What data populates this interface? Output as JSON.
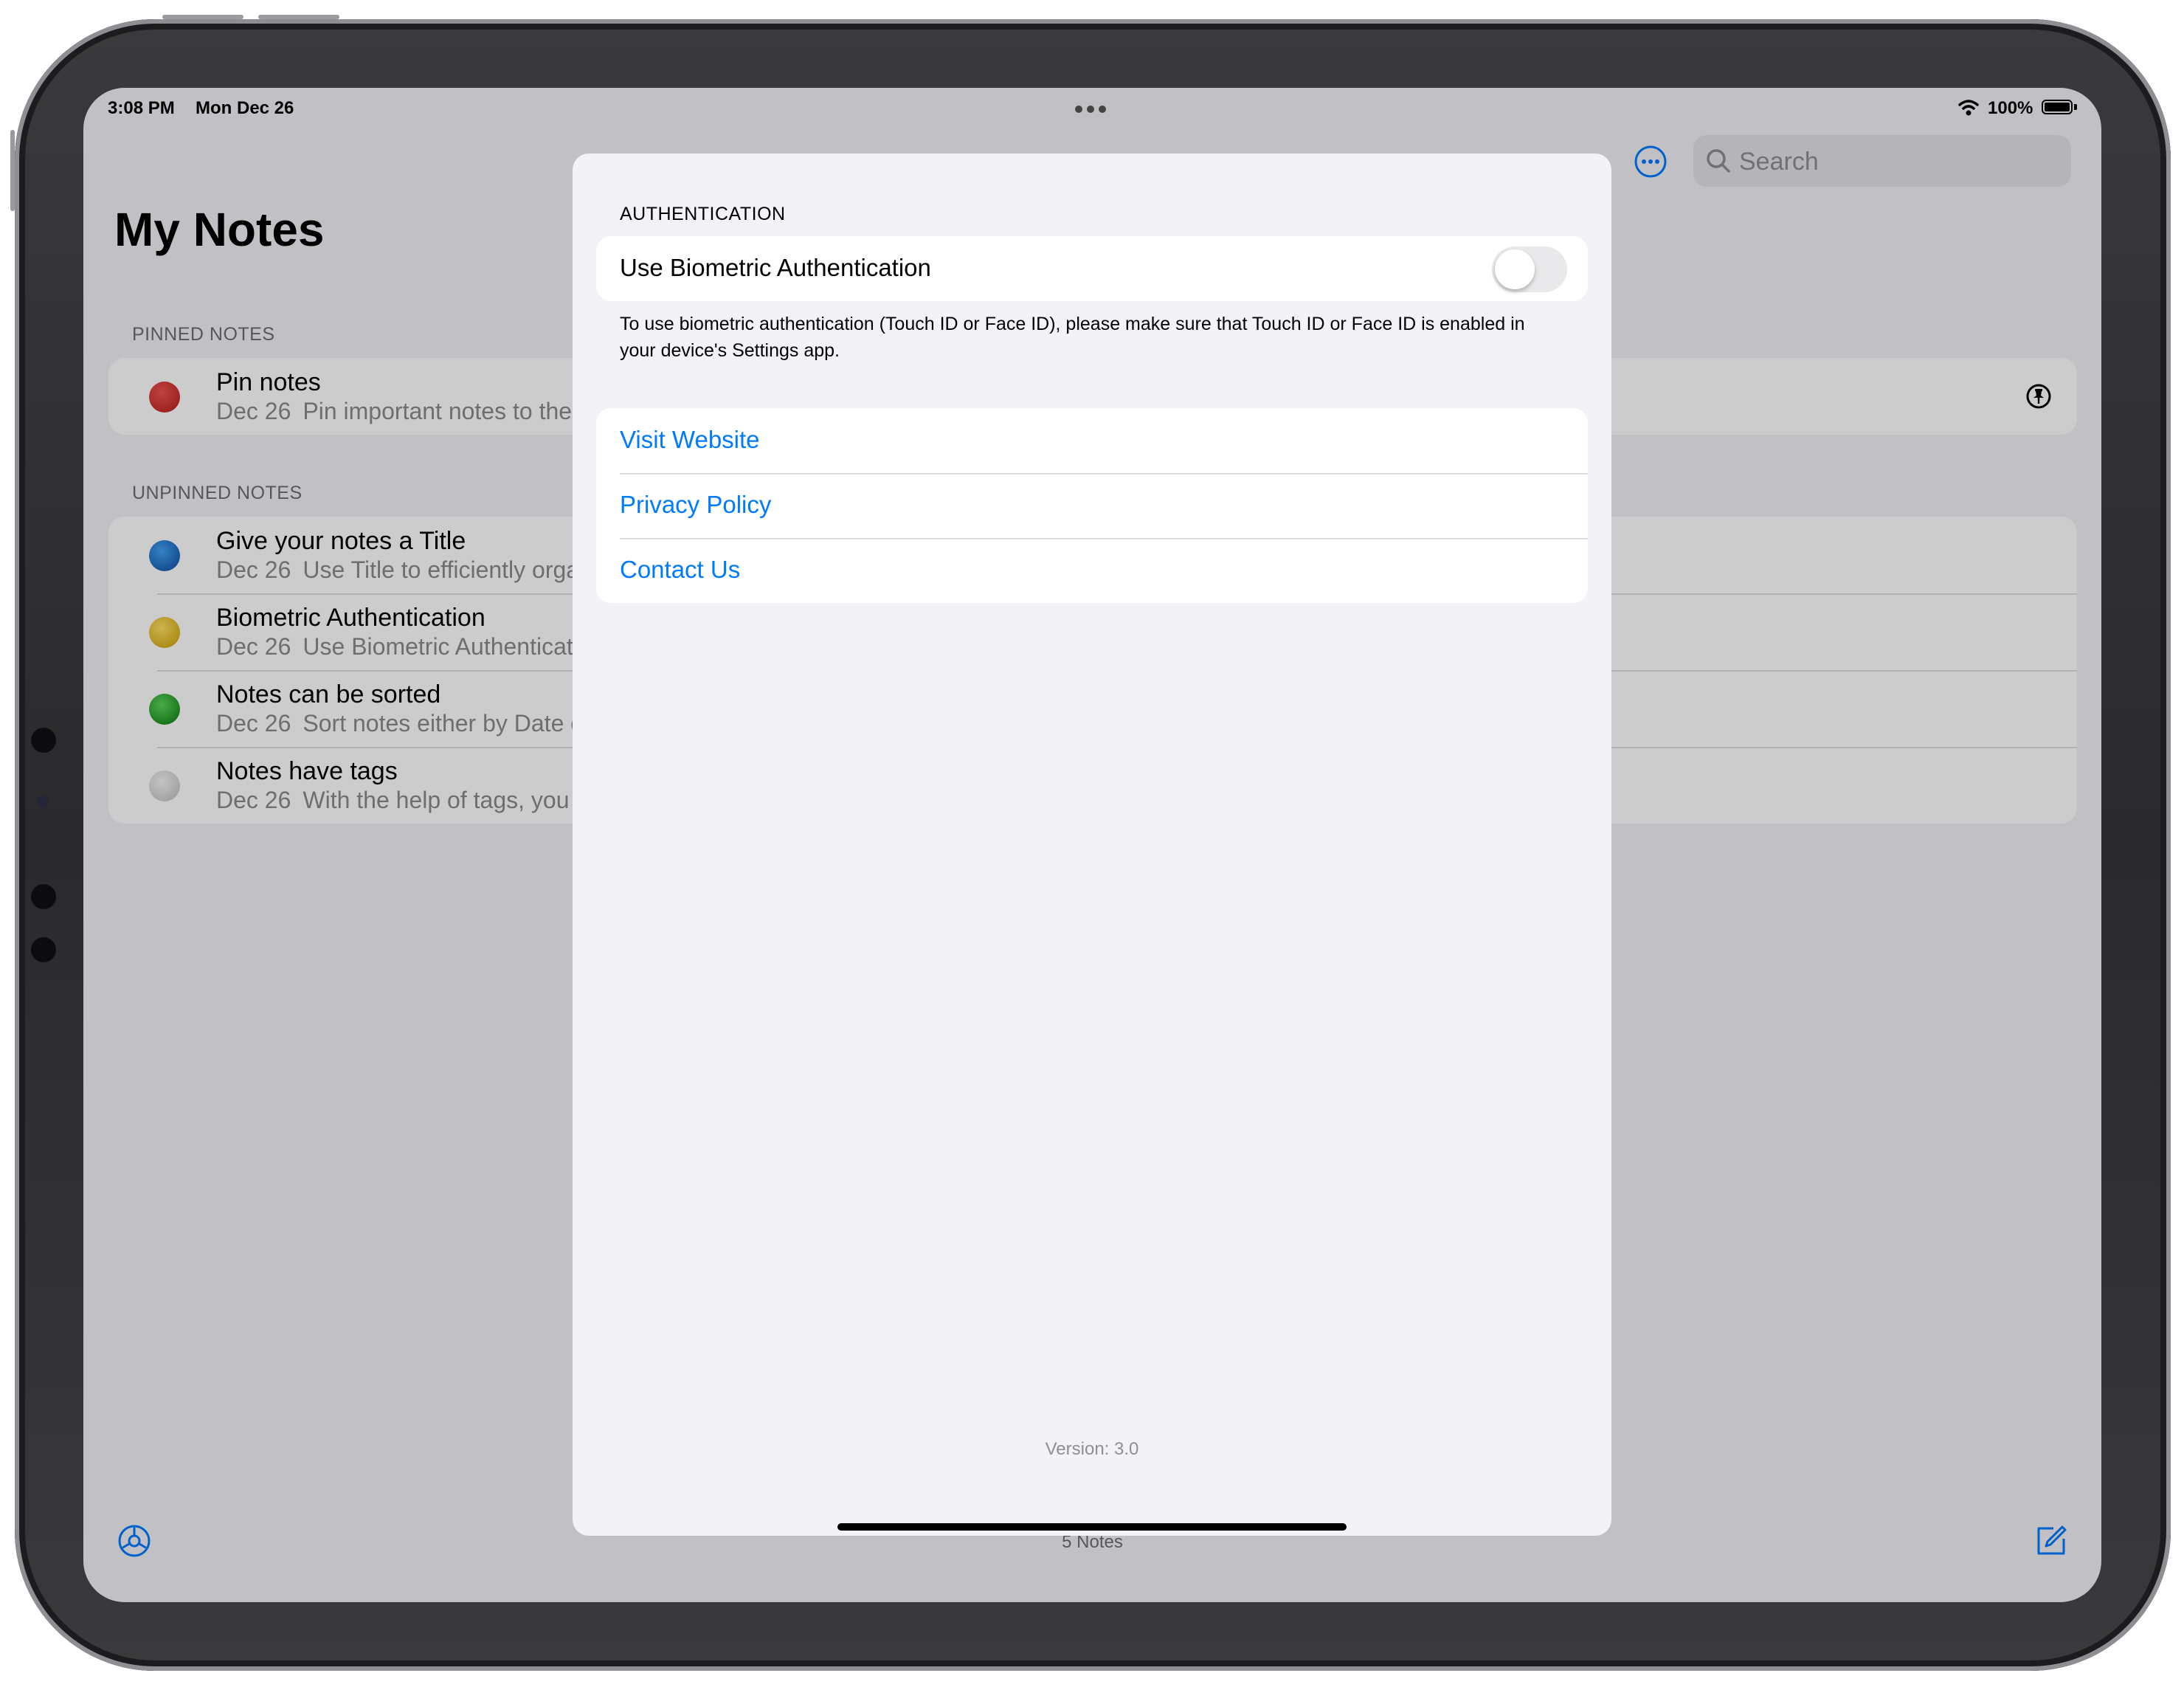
{
  "status_bar": {
    "time": "3:08 PM",
    "date": "Mon Dec 26",
    "battery": "100%"
  },
  "main": {
    "title": "My Notes",
    "search_placeholder": "Search",
    "pinned_header": "PINNED NOTES",
    "unpinned_header": "UNPINNED NOTES",
    "pinned_notes": [
      {
        "title": "Pin notes",
        "date": "Dec 26",
        "preview": "Pin important notes to the top",
        "color": "#d32f2f"
      }
    ],
    "unpinned_notes": [
      {
        "title": "Give your notes a Title",
        "date": "Dec 26",
        "preview": "Use Title to efficiently organize",
        "color": "#1565c0"
      },
      {
        "title": "Biometric Authentication",
        "date": "Dec 26",
        "preview": "Use Biometric Authentication",
        "color": "#f4c20d"
      },
      {
        "title": "Notes can be sorted",
        "date": "Dec 26",
        "preview": "Sort notes either by Date or",
        "color": "#1fa81f"
      },
      {
        "title": "Notes have tags",
        "date": "Dec 26",
        "preview": "With the help of tags, you can",
        "color": "#e0e0e0"
      }
    ],
    "notes_count": "5 Notes"
  },
  "settings_modal": {
    "section_header": "AUTHENTICATION",
    "biometric_label": "Use Biometric Authentication",
    "biometric_enabled": false,
    "footer_text": "To use biometric authentication (Touch ID or Face ID), please make sure that Touch ID or Face ID is enabled in your device's Settings app.",
    "links": [
      "Visit Website",
      "Privacy Policy",
      "Contact Us"
    ],
    "version": "Version: 3.0"
  },
  "colors": {
    "accent": "#007aff",
    "background": "#f2f2f7"
  }
}
